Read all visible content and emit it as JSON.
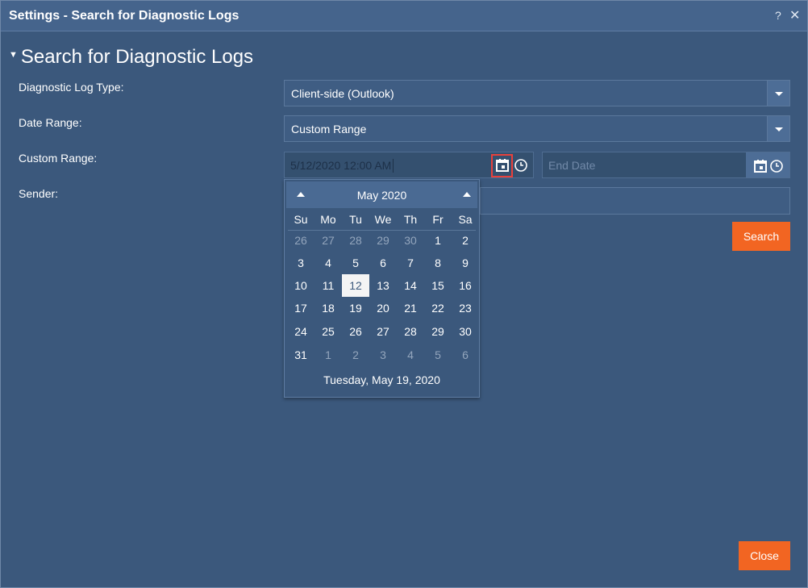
{
  "window": {
    "title": "Settings - Search for Diagnostic Logs",
    "help_label": "?",
    "close_label": "✕"
  },
  "section": {
    "title": "Search for Diagnostic Logs"
  },
  "form": {
    "log_type": {
      "label": "Diagnostic Log Type:",
      "value": "Client-side (Outlook)"
    },
    "date_range": {
      "label": "Date Range:",
      "value": "Custom Range"
    },
    "custom_range": {
      "label": "Custom Range:",
      "start_value": "5/12/2020 12:00 AM",
      "end_placeholder": "End Date"
    },
    "sender": {
      "label": "Sender:",
      "value": ""
    },
    "search_label": "Search",
    "close_label": "Close"
  },
  "calendar": {
    "month_label": "May 2020",
    "weekdays": [
      "Su",
      "Mo",
      "Tu",
      "We",
      "Th",
      "Fr",
      "Sa"
    ],
    "weeks": [
      [
        "26",
        "27",
        "28",
        "29",
        "30",
        "1",
        "2"
      ],
      [
        "3",
        "4",
        "5",
        "6",
        "7",
        "8",
        "9"
      ],
      [
        "10",
        "11",
        "12",
        "13",
        "14",
        "15",
        "16"
      ],
      [
        "17",
        "18",
        "19",
        "20",
        "21",
        "22",
        "23"
      ],
      [
        "24",
        "25",
        "26",
        "27",
        "28",
        "29",
        "30"
      ],
      [
        "31",
        "1",
        "2",
        "3",
        "4",
        "5",
        "6"
      ]
    ],
    "selected_day": "12",
    "footer": "Tuesday, May 19, 2020"
  },
  "colors": {
    "accent": "#f26522",
    "background": "#3b587c",
    "header": "#45648c",
    "highlight": "#e8413c"
  },
  "icons": [
    "calendar-icon",
    "clock-icon",
    "dropdown-arrow-icon",
    "help-icon",
    "close-icon",
    "collapse-caret-icon"
  ]
}
